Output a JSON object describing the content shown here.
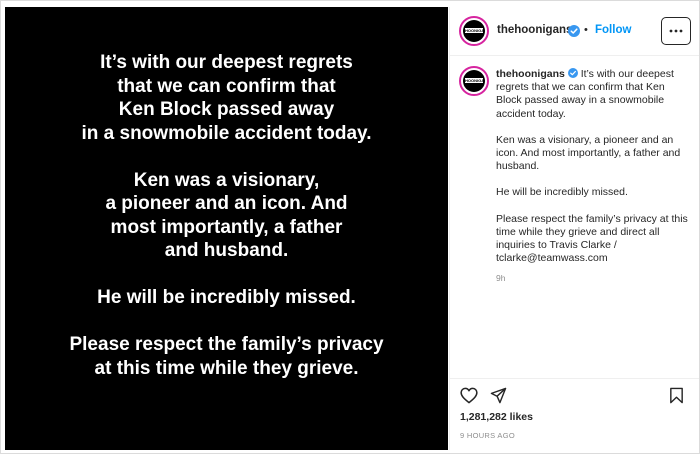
{
  "post": {
    "image_text": [
      "It’s with our deepest regrets\nthat we can confirm that\nKen Block passed away\nin a snowmobile accident today.",
      "Ken was a visionary,\na pioneer and an icon. And\nmost importantly, a father\nand husband.",
      "He will be incredibly missed.",
      "Please respect the family’s privacy\nat this time while they grieve."
    ]
  },
  "header": {
    "avatar_text": "HOONIGAN",
    "username": "thehoonigans",
    "dot": "•",
    "follow_label": "Follow",
    "more_icon": "more-horizontal-icon"
  },
  "caption": {
    "avatar_text": "HOONIGAN",
    "username": "thehoonigans",
    "paragraphs": [
      "It’s with our deepest regrets that we can confirm that Ken Block passed away in a snowmobile accident today.",
      "Ken was a visionary, a pioneer and an icon. And most importantly, a father and husband.",
      "He will be incredibly missed.",
      "Please respect the family’s privacy at this time while they grieve and direct all inquiries to Travis Clarke / tclarke@teamwass.com"
    ],
    "time": "9h"
  },
  "actions": {
    "like_icon": "heart-icon",
    "share_icon": "send-icon",
    "save_icon": "bookmark-icon",
    "likes": "1,281,282 likes",
    "posted": "9 HOURS AGO"
  },
  "colors": {
    "follow": "#0095f6",
    "verified": "#3897f0",
    "ring": "#d6249f"
  }
}
